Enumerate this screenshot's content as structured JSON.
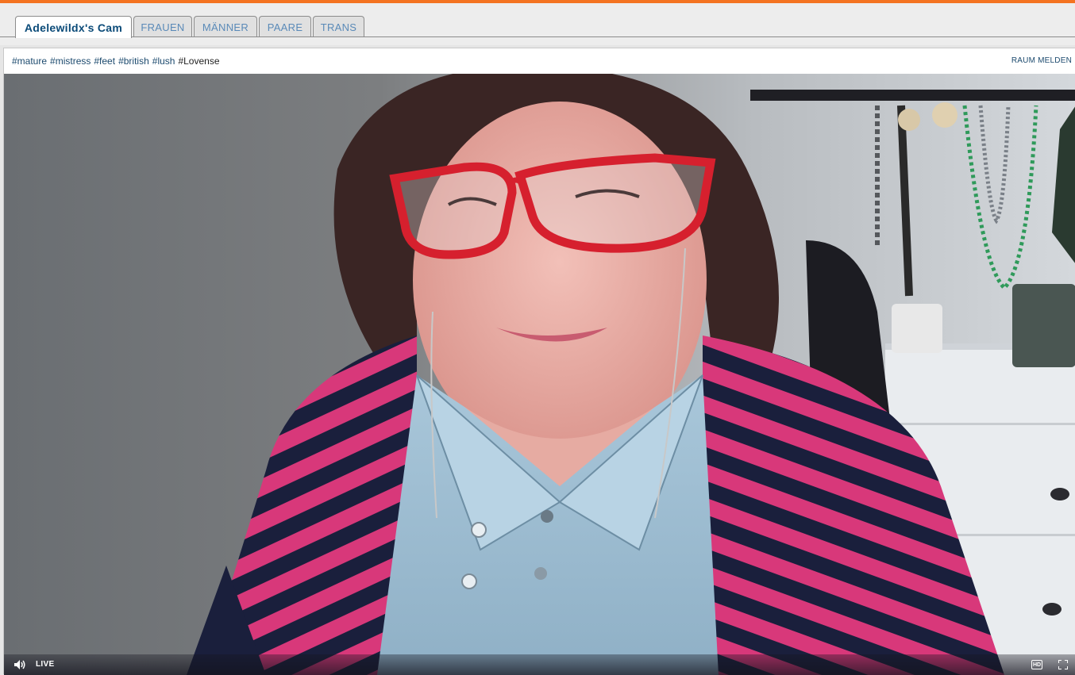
{
  "tabs": [
    {
      "label": "Adelewildx's Cam",
      "active": true
    },
    {
      "label": "FRAUEN",
      "active": false
    },
    {
      "label": "MÄNNER",
      "active": false
    },
    {
      "label": "PAARE",
      "active": false
    },
    {
      "label": "TRANS",
      "active": false
    }
  ],
  "room": {
    "tags": [
      "#mature",
      "#mistress",
      "#feet",
      "#british",
      "#lush",
      "#Lovense"
    ],
    "report_label": "RAUM MELDEN"
  },
  "player": {
    "live_label": "LIVE",
    "hd_label": "HD",
    "icons": [
      "volume-icon",
      "hd-icon",
      "fullscreen-icon"
    ]
  },
  "colors": {
    "accent": "#f47321",
    "tab_link": "#5a8ab8",
    "tab_active": "#0a4a78",
    "tag_link": "#1c4a6e"
  }
}
